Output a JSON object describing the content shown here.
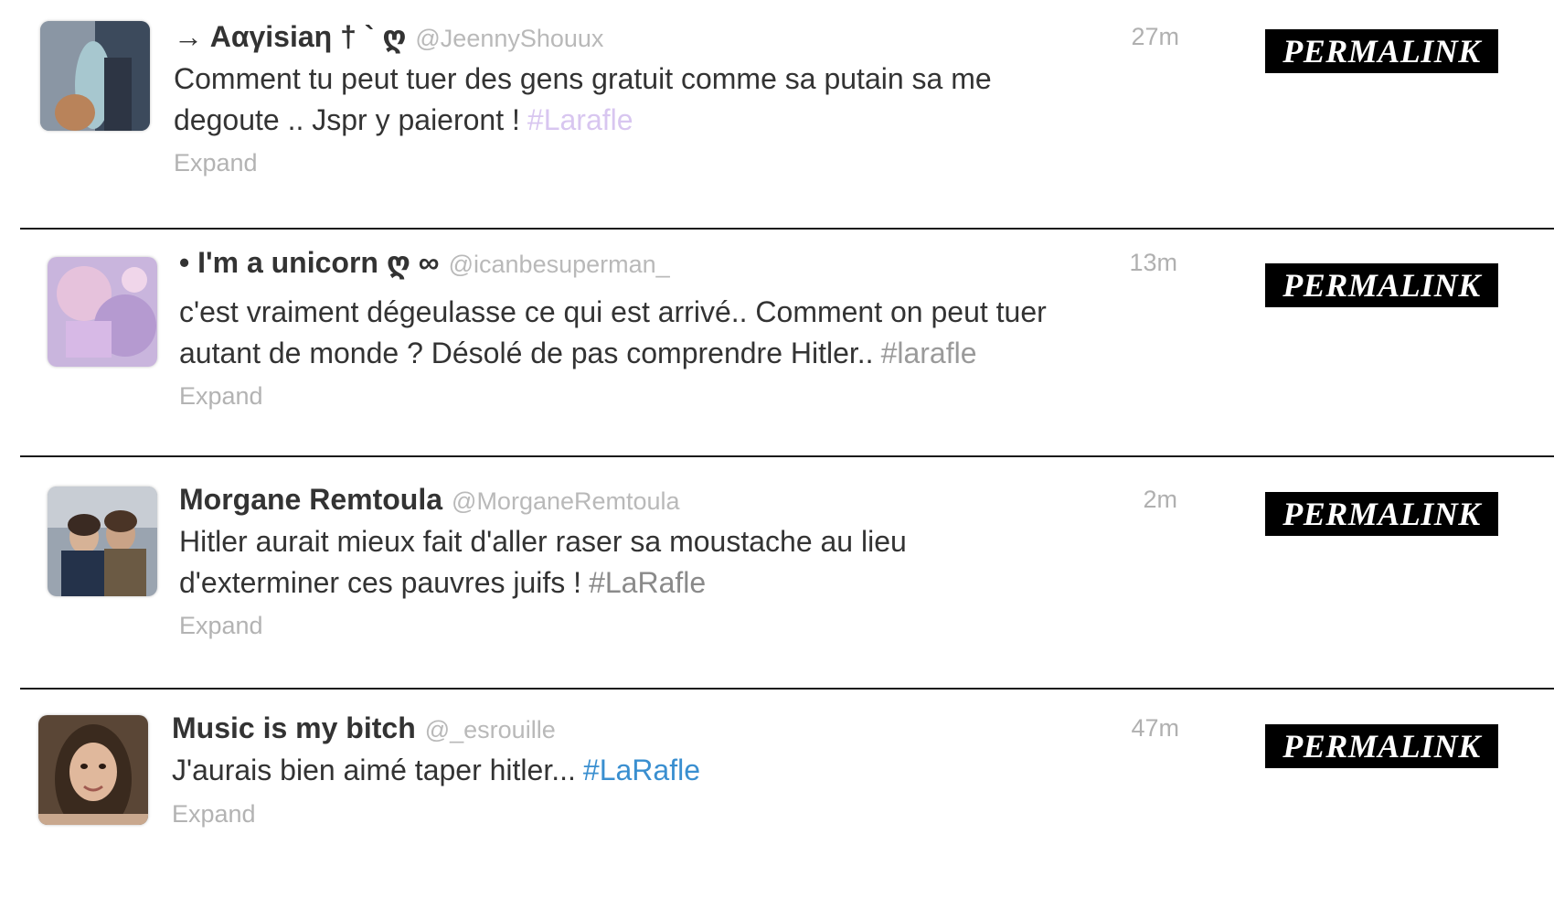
{
  "tweets": [
    {
      "name": "→ Aαγisiaη † ` ღ",
      "handle": "@JeennyShouux",
      "time": "27m",
      "text_line1": "Comment tu peut tuer des gens gratuit comme sa putain sa me",
      "text_line2": "degoute .. Jspr y paieront !",
      "hashtag": "#Larafle",
      "hashtag_color": "#d8c6f0",
      "expand": "Expand",
      "permalink": "PERMALINK"
    },
    {
      "name": "• I'm a unicorn ღ ∞",
      "handle": "@icanbesuperman_",
      "time": "13m",
      "text_line1": "c'est vraiment dégeulasse ce qui est arrivé.. Comment on peut tuer",
      "text_line2": "autant de monde ? Désolé de pas comprendre Hitler..",
      "hashtag": "#larafle",
      "hashtag_color": "#9a9a9a",
      "expand": "Expand",
      "permalink": "PERMALINK"
    },
    {
      "name": "Morgane Remtoula",
      "handle": "@MorganeRemtoula",
      "time": "2m",
      "text_line1": "Hitler aurait mieux fait d'aller raser sa moustache au lieu",
      "text_line2": "d'exterminer ces pauvres juifs !",
      "hashtag": "#LaRafle",
      "hashtag_color": "#8a8a8a",
      "expand": "Expand",
      "permalink": "PERMALINK"
    },
    {
      "name": "Music is my bitch",
      "handle": "@_esrouille",
      "time": "47m",
      "text_line1": "J'aurais bien aimé taper hitler...",
      "text_line2": "",
      "hashtag": "#LaRafle",
      "hashtag_color": "#3a8fd0",
      "expand": "Expand",
      "permalink": "PERMALINK"
    }
  ]
}
